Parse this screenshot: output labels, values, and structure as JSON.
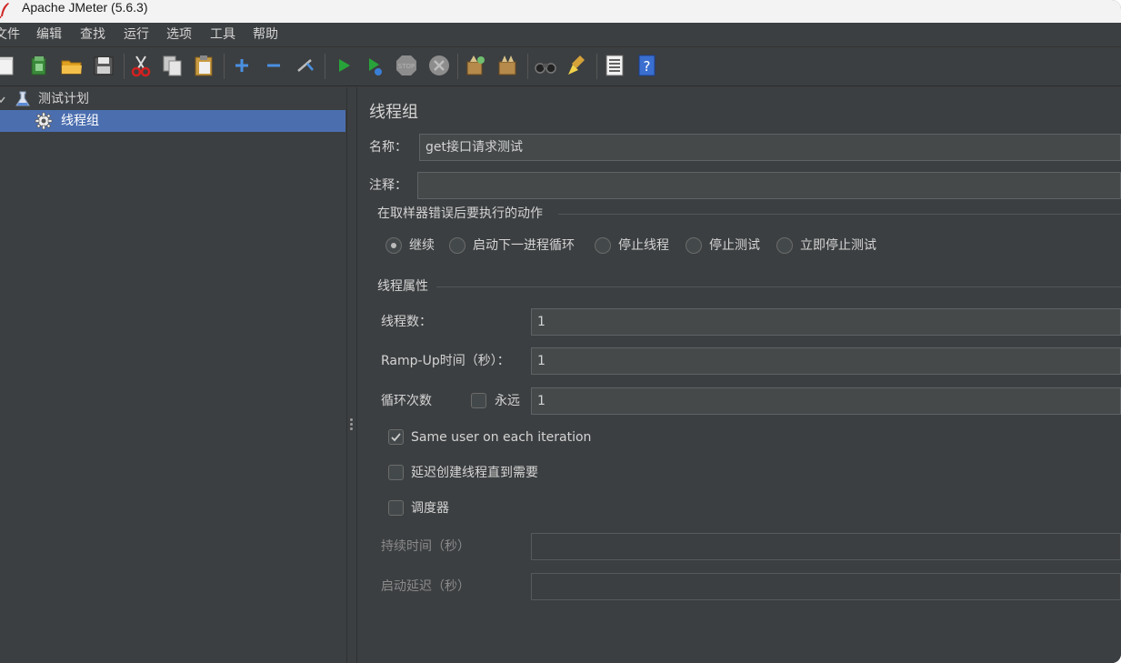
{
  "window": {
    "title": "Apache JMeter (5.6.3)"
  },
  "menu": [
    "文件",
    "编辑",
    "查找",
    "运行",
    "选项",
    "工具",
    "帮助"
  ],
  "toolbar": [
    "new-icon",
    "templates-icon",
    "open-icon",
    "save-icon",
    "cut-icon",
    "copy-icon",
    "paste-icon",
    "expand-icon",
    "collapse-icon",
    "toggle-icon",
    "start-icon",
    "start-no-pause-icon",
    "stop-icon",
    "shutdown-icon",
    "clear-icon",
    "clear-all-icon",
    "search-icon",
    "reset-search-icon",
    "function-helper-icon",
    "help-icon"
  ],
  "tree": {
    "root": "测试计划",
    "child": "线程组"
  },
  "editor": {
    "heading": "线程组",
    "name_label": "名称：",
    "name_value": "get接口请求测试",
    "comment_label": "注释：",
    "comment_value": "",
    "on_error": {
      "title": "在取样器错误后要执行的动作",
      "options": [
        "继续",
        "启动下一进程循环",
        "停止线程",
        "停止测试",
        "立即停止测试"
      ],
      "selected": "继续"
    },
    "props": {
      "title": "线程属性",
      "threads_label": "线程数：",
      "threads_value": "1",
      "rampup_label": "Ramp-Up时间（秒）：",
      "rampup_value": "1",
      "loop_label": "循环次数",
      "forever_label": "永远",
      "forever_checked": false,
      "loop_value": "1",
      "same_user_label": "Same user on each iteration",
      "same_user_checked": true,
      "delay_label": "延迟创建线程直到需要",
      "delay_checked": false,
      "scheduler_label": "调度器",
      "scheduler_checked": false,
      "duration_label": "持续时间（秒）",
      "duration_value": "",
      "startup_label": "启动延迟（秒）",
      "startup_value": ""
    }
  }
}
